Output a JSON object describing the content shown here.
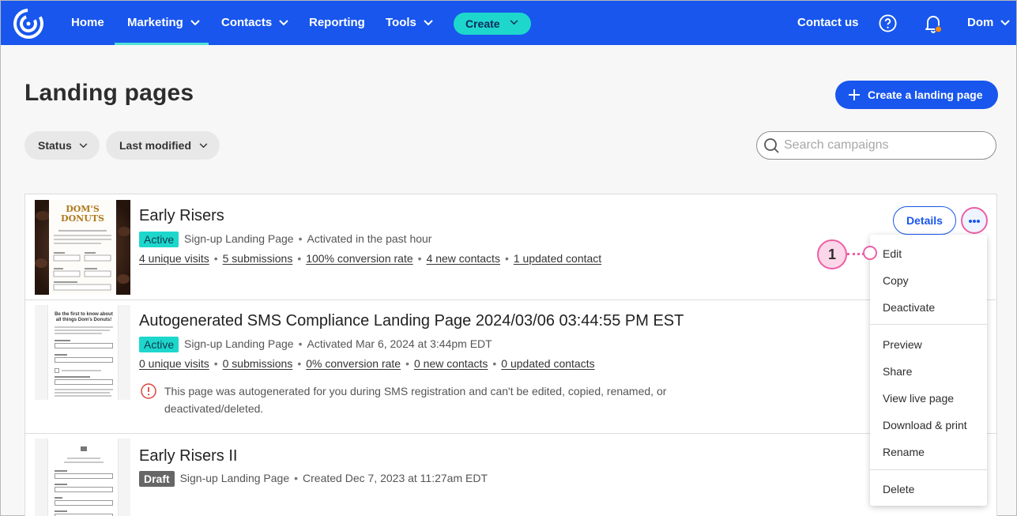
{
  "nav": {
    "items": [
      "Home",
      "Marketing",
      "Contacts",
      "Reporting",
      "Tools"
    ],
    "create": "Create",
    "contact_us": "Contact us",
    "user": "Dom",
    "accent": "#1856ed",
    "active_item": "Marketing"
  },
  "header": {
    "title": "Landing pages",
    "create_button": "Create a landing page"
  },
  "filters": {
    "status": "Status",
    "last_modified": "Last modified"
  },
  "search": {
    "placeholder": "Search campaigns"
  },
  "rows": [
    {
      "name": "Early Risers",
      "badge": "Active",
      "type": "Sign-up Landing Page",
      "time": "Activated in the past hour",
      "stats": [
        "4 unique visits",
        "5 submissions",
        "100% conversion rate",
        "4 new contacts",
        "1 updated contact"
      ],
      "thumb_brand_1": "DOM'S",
      "thumb_brand_2": "DONUTS"
    },
    {
      "name": "Autogenerated SMS Compliance Landing Page 2024/03/06 03:44:55 PM EST",
      "badge": "Active",
      "type": "Sign-up Landing Page",
      "time": "Activated Mar 6, 2024 at 3:44pm EDT",
      "stats": [
        "0 unique visits",
        "0 submissions",
        "0% conversion rate",
        "0 new contacts",
        "0 updated contacts"
      ],
      "notice": "This page was autogenerated for you during SMS registration and can't be edited, copied, renamed, or deactivated/deleted.",
      "thumb_heading": "Be the first to know about all things Dom's Donuts!"
    },
    {
      "name": "Early Risers II",
      "badge": "Draft",
      "type": "Sign-up Landing Page",
      "time": "Created Dec 7, 2023 at 11:27am EDT"
    }
  ],
  "row_actions": {
    "details": "Details"
  },
  "menu": {
    "items": [
      "Edit",
      "Copy",
      "Deactivate",
      "Preview",
      "Share",
      "View live page",
      "Download & print",
      "Rename",
      "Delete"
    ]
  },
  "callout": {
    "number": "1",
    "color": "#ee5fa5"
  }
}
